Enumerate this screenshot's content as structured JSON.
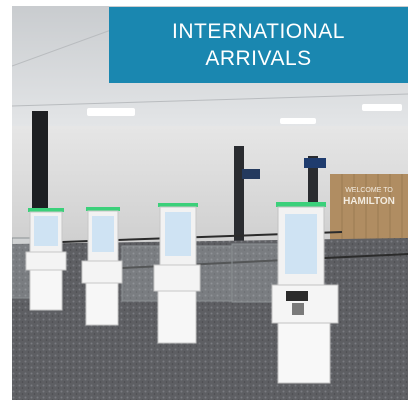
{
  "banner": {
    "line1": "INTERNATIONAL",
    "line2": "ARRIVALS",
    "color": "#1a87b0"
  },
  "photo": {
    "wall_sign": {
      "line1": "WELCOME TO",
      "line2": "HAMILTON"
    }
  }
}
